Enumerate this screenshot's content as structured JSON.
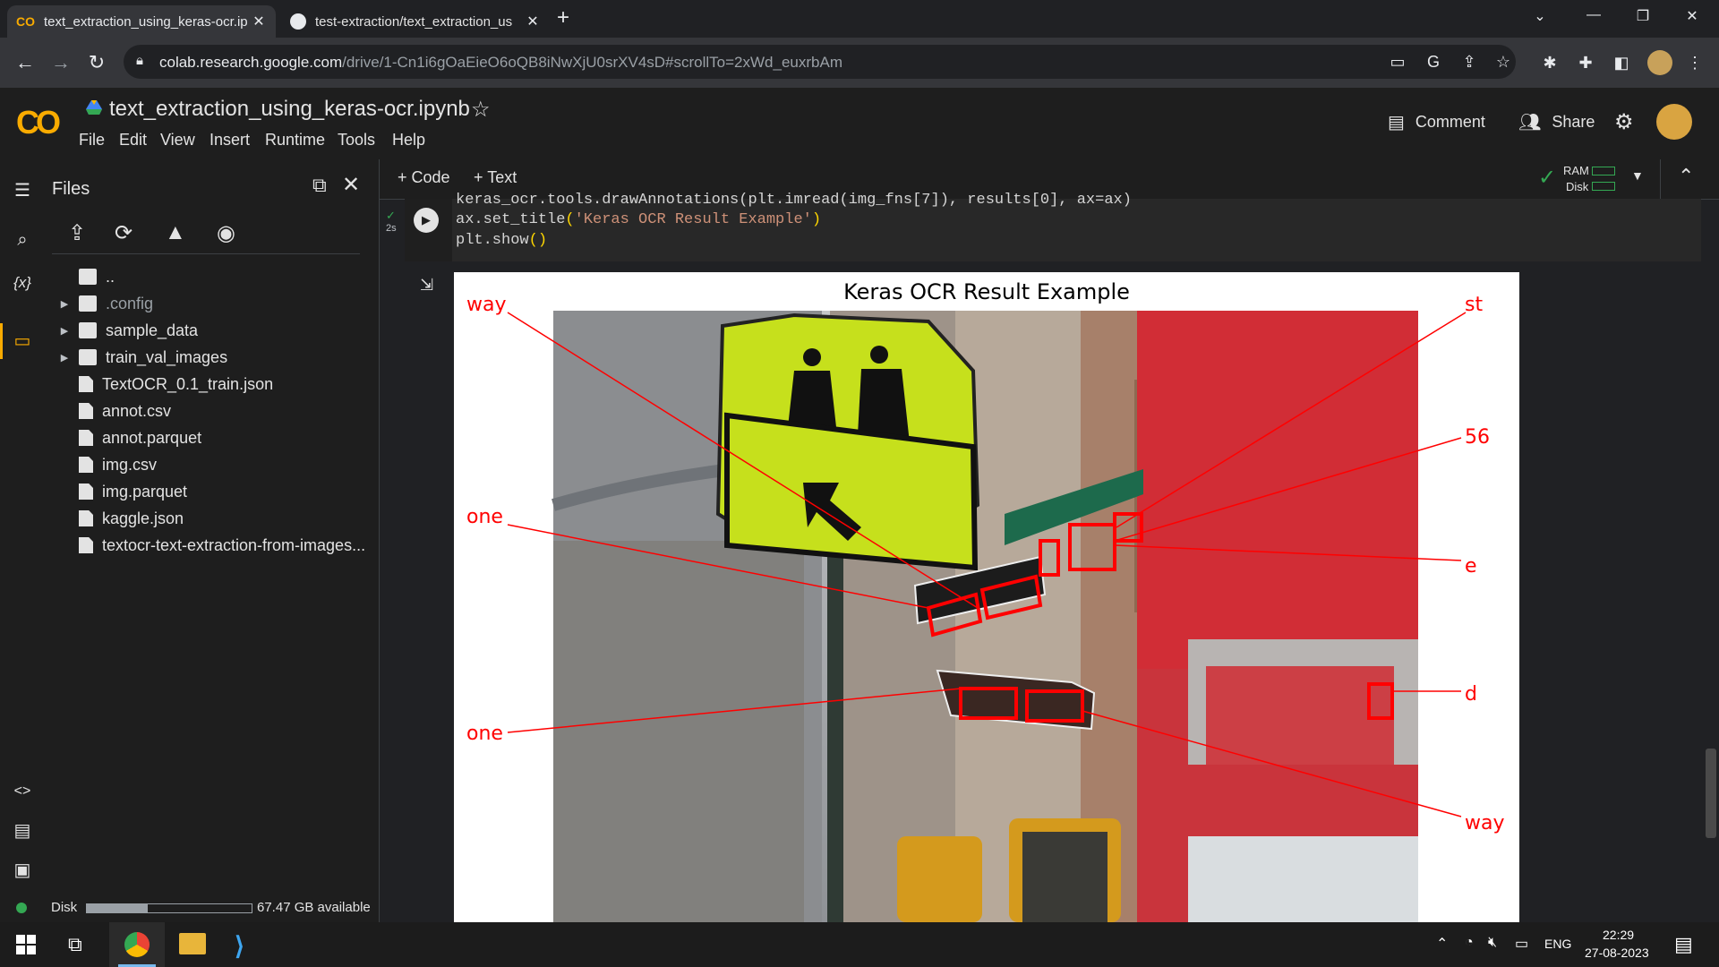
{
  "browser": {
    "tabs": [
      {
        "title": "text_extraction_using_keras-ocr.ip",
        "active": true,
        "icon": "colab-icon"
      },
      {
        "title": "test-extraction/text_extraction_us",
        "active": false,
        "icon": "github-icon"
      }
    ],
    "url_host": "colab.research.google.com",
    "url_path": "/drive/1-Cn1i6gOaEieO6oQB8iNwXjU0srXV4sD#scrollTo=2xWd_euxrbAm"
  },
  "colab": {
    "logo": "CO",
    "notebook_title": "text_extraction_using_keras-ocr.ipynb",
    "menu": [
      "File",
      "Edit",
      "View",
      "Insert",
      "Runtime",
      "Tools",
      "Help"
    ],
    "comment_label": "Comment",
    "share_label": "Share",
    "add_code_label": "+ Code",
    "add_text_label": "+ Text",
    "ram_label": "RAM",
    "disk_label": "Disk",
    "accent": "#f9ab00"
  },
  "files_panel": {
    "title": "Files",
    "items": [
      {
        "name": "..",
        "type": "folder-up",
        "expandable": false
      },
      {
        "name": ".config",
        "type": "folder",
        "expandable": true
      },
      {
        "name": "sample_data",
        "type": "folder",
        "expandable": true
      },
      {
        "name": "train_val_images",
        "type": "folder",
        "expandable": true
      },
      {
        "name": "TextOCR_0.1_train.json",
        "type": "file",
        "expandable": false
      },
      {
        "name": "annot.csv",
        "type": "file",
        "expandable": false
      },
      {
        "name": "annot.parquet",
        "type": "file",
        "expandable": false
      },
      {
        "name": "img.csv",
        "type": "file",
        "expandable": false
      },
      {
        "name": "img.parquet",
        "type": "file",
        "expandable": false
      },
      {
        "name": "kaggle.json",
        "type": "file",
        "expandable": false
      },
      {
        "name": "textocr-text-extraction-from-images...",
        "type": "file",
        "expandable": false
      }
    ],
    "disk_label": "Disk",
    "disk_available": "67.47 GB available",
    "disk_used_fraction": 0.37
  },
  "cell": {
    "exec_time": "2s",
    "code_lines": [
      "keras_ocr.tools.drawAnnotations(plt.imread(img_fns[7]), results[0], ax=ax)",
      "ax.set_title('Keras OCR Result Example')",
      "plt.show()"
    ]
  },
  "output_figure": {
    "title": "Keras OCR Result Example",
    "left_labels": [
      "way",
      "one",
      "one"
    ],
    "right_labels": [
      "st",
      "56",
      "e",
      "d",
      "way"
    ],
    "box_color": "#ff0000"
  },
  "taskbar": {
    "language": "ENG",
    "time": "22:29",
    "date": "27-08-2023"
  }
}
